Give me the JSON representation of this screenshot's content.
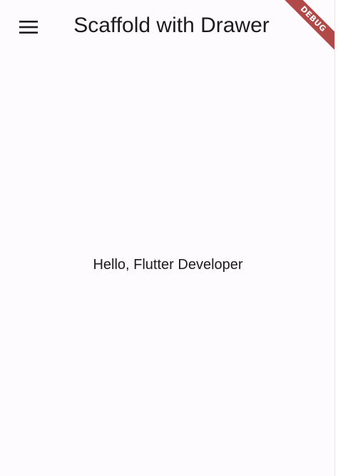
{
  "app_bar": {
    "title": "Scaffold with Drawer",
    "menu_icon": "menu-icon"
  },
  "body": {
    "text": "Hello, Flutter Developer"
  },
  "debug_banner": {
    "label": "DEBUG",
    "color": "#a52a2a"
  },
  "colors": {
    "background": "#fdfbfe",
    "text": "#1c1b1f"
  }
}
